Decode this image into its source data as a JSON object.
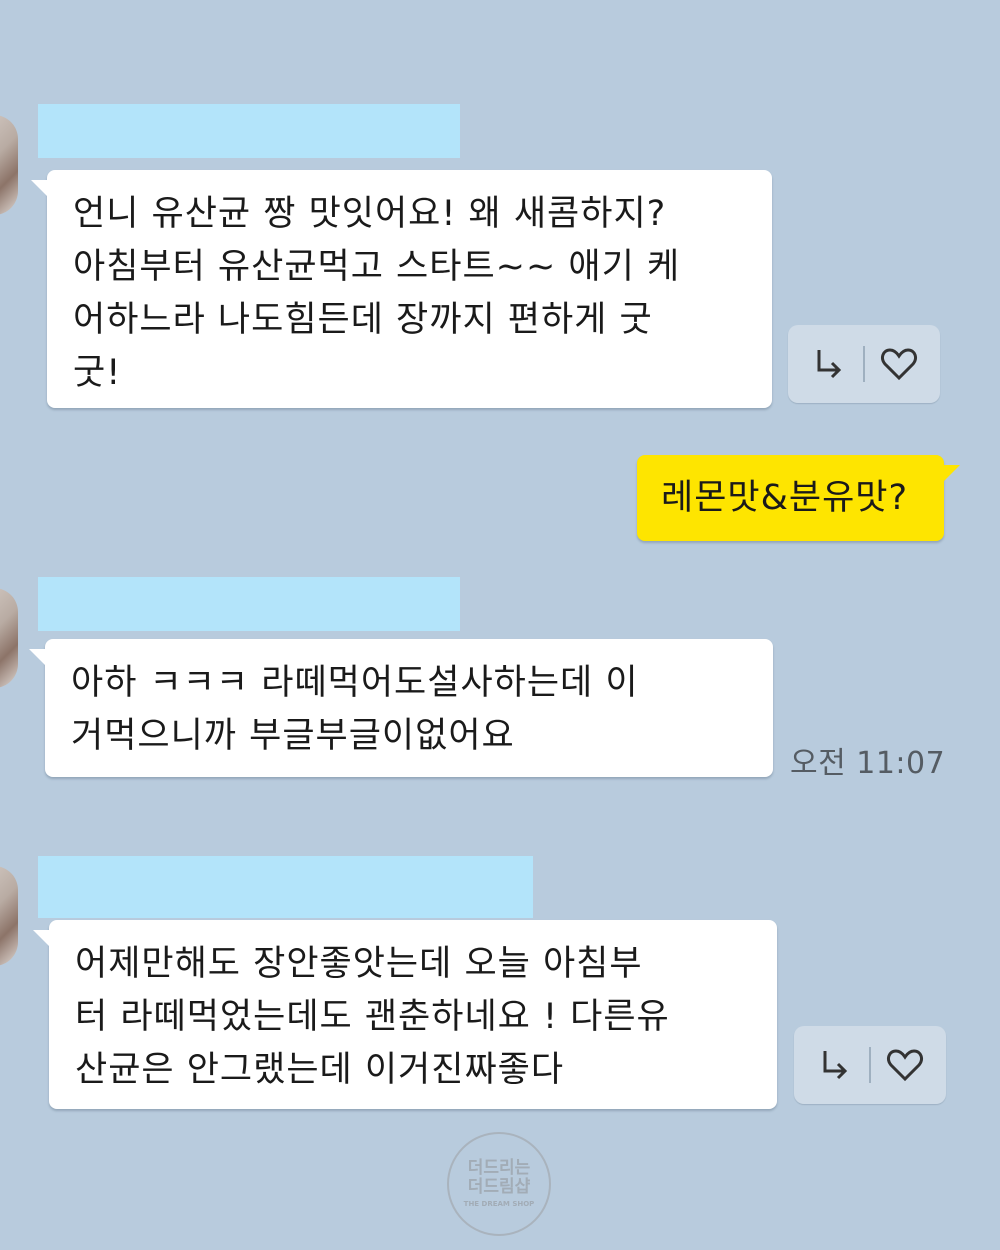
{
  "messages": [
    {
      "text": "언니 유산균 짱 맛잇어요! 왜 새콤하지?\n아침부터 유산균먹고 스타트~~ 애기 케\n어하느라 나도힘든데 장까지 편하게 굿\n굿!"
    },
    {
      "text": "레몬맛&분유맛?"
    },
    {
      "text": "아하 ㅋㅋㅋ 라떼먹어도설사하는데 이\n거먹으니까 부글부글이없어요",
      "time": "오전 11:07"
    },
    {
      "text": "어제만해도 장안좋앗는데 오늘 아침부\n터 라떼먹었는데도 괜춘하네요 ! 다른유\n산균은 안그랬는데 이거진짜좋다"
    }
  ],
  "icons": {
    "reply": "reply-arrow-icon",
    "like": "heart-icon"
  },
  "watermark": {
    "line1": "더드리는",
    "line2": "더드림샵",
    "line3": "THE DREAM SHOP"
  },
  "colors": {
    "background": "#b8cbdd",
    "my_bubble": "#fee500",
    "other_bubble": "#ffffff",
    "name_redaction": "#b3e4fa"
  }
}
